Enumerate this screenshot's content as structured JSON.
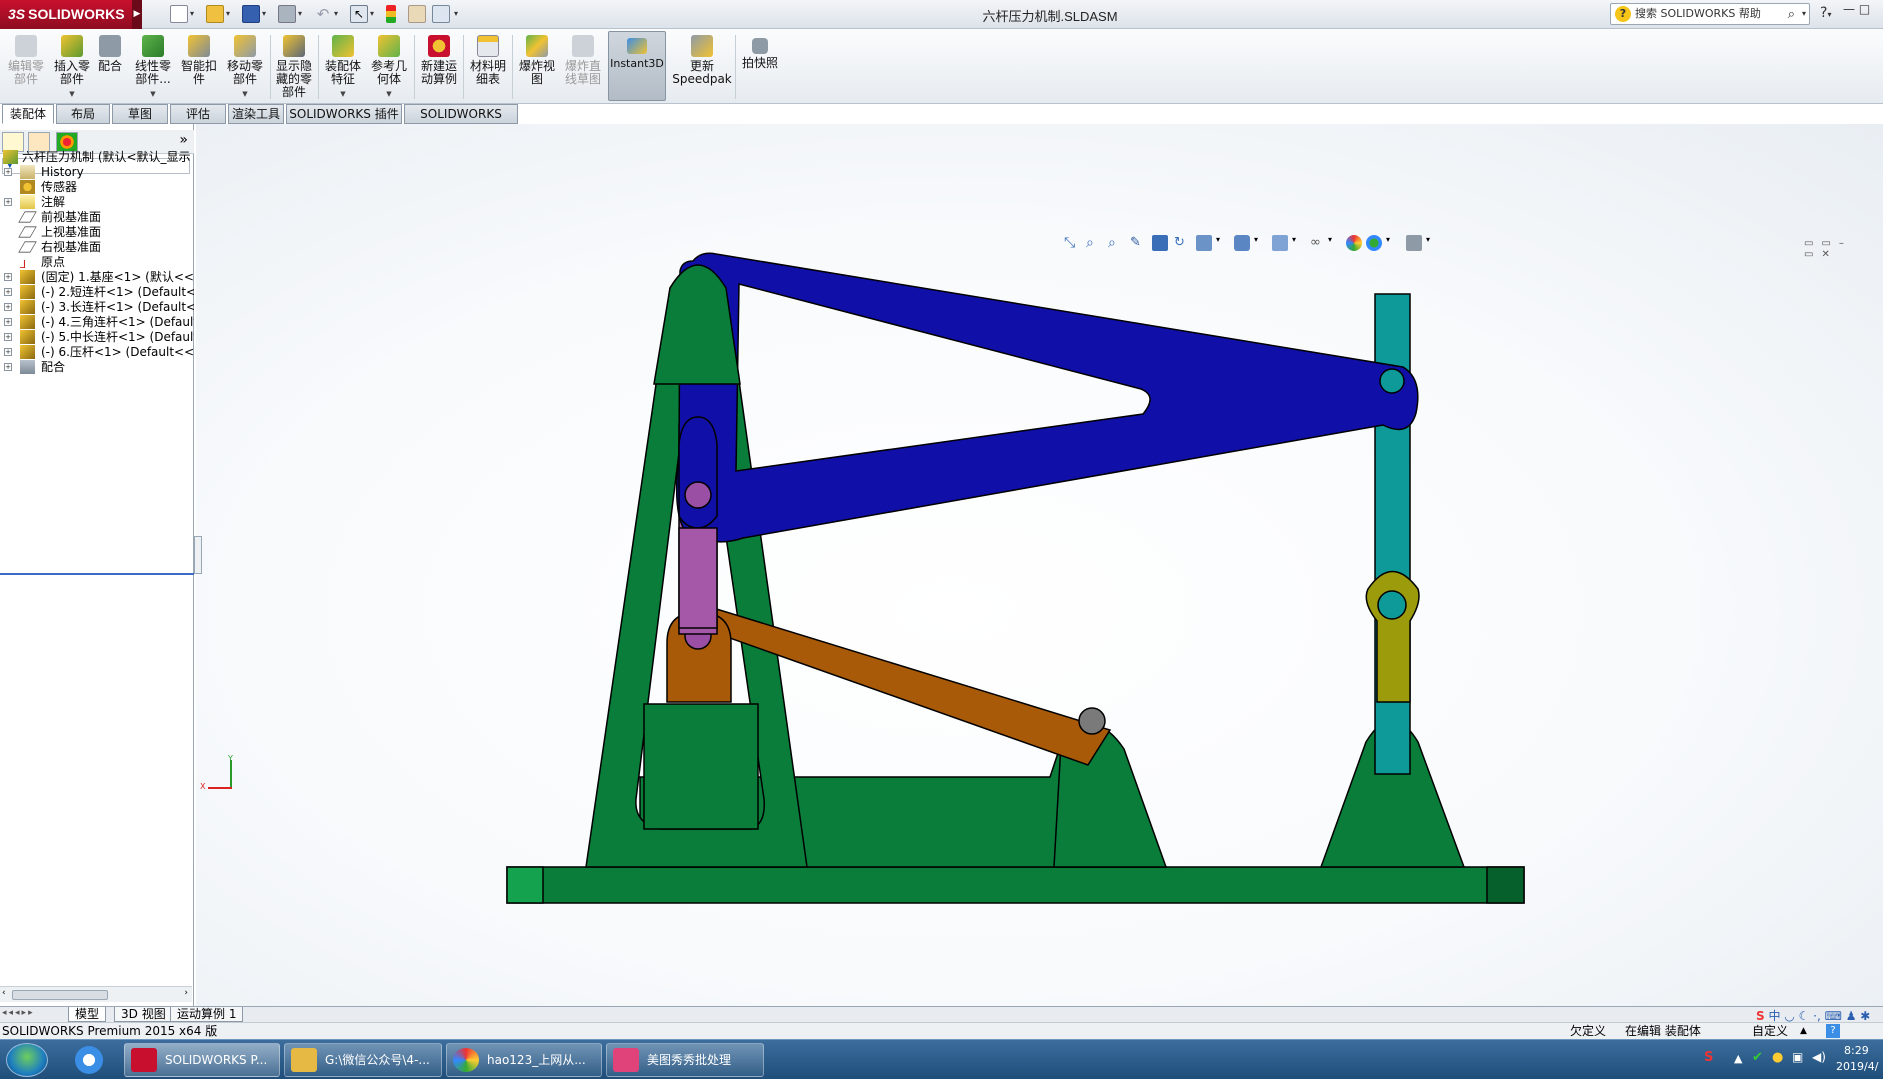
{
  "app": {
    "logo_text": "SOLIDWORKS",
    "window_title": "六杆压力机制.SLDASM",
    "search_placeholder": "搜索 SOLIDWORKS 帮助"
  },
  "toolbar": {
    "commands": [
      {
        "id": "edit-component",
        "label": "编辑零\n部件",
        "enabled": false,
        "icon": "edit-component-icon"
      },
      {
        "id": "insert-component",
        "label": "插入零\n部件",
        "enabled": true,
        "icon": "insert-component-icon"
      },
      {
        "id": "mate",
        "label": "配合",
        "enabled": true,
        "icon": "mate-icon"
      },
      {
        "id": "linear-pattern",
        "label": "线性零\n部件...",
        "enabled": true,
        "icon": "linear-pattern-icon"
      },
      {
        "id": "smart-fasteners",
        "label": "智能扣\n件",
        "enabled": true,
        "icon": "smart-fasteners-icon"
      },
      {
        "id": "move-component",
        "label": "移动零\n部件",
        "enabled": true,
        "icon": "move-component-icon"
      },
      {
        "id": "show-hidden",
        "label": "显示隐\n藏的零\n部件",
        "enabled": true,
        "icon": "show-hidden-icon"
      },
      {
        "id": "assembly-features",
        "label": "装配体\n特征",
        "enabled": true,
        "icon": "assembly-features-icon"
      },
      {
        "id": "reference-geometry",
        "label": "参考几\n何体",
        "enabled": true,
        "icon": "reference-geometry-icon"
      },
      {
        "id": "new-motion-study",
        "label": "新建运\n动算例",
        "enabled": true,
        "icon": "motion-study-icon"
      },
      {
        "id": "bom",
        "label": "材料明\n细表",
        "enabled": true,
        "icon": "bom-icon"
      },
      {
        "id": "exploded-view",
        "label": "爆炸视\n图",
        "enabled": true,
        "icon": "exploded-view-icon"
      },
      {
        "id": "explode-line",
        "label": "爆炸直\n线草图",
        "enabled": false,
        "icon": "explode-line-icon"
      },
      {
        "id": "instant3d",
        "label": "Instant3D",
        "enabled": true,
        "active": true,
        "icon": "instant3d-icon"
      },
      {
        "id": "update-speedpak",
        "label": "更新\nSpeedpak",
        "enabled": true,
        "icon": "speedpak-icon"
      },
      {
        "id": "snapshot",
        "label": "拍快照",
        "enabled": true,
        "icon": "snapshot-icon"
      }
    ]
  },
  "tabs": [
    "装配体",
    "布局",
    "草图",
    "评估",
    "渲染工具",
    "SOLIDWORKS 插件",
    "SOLIDWORKS MBD"
  ],
  "feature_tree": {
    "root": "六杆压力机制 (默认<默认_显示",
    "items": [
      {
        "label": "History",
        "icon": "history-icon",
        "expandable": true
      },
      {
        "label": "传感器",
        "icon": "sensor-icon",
        "expandable": false
      },
      {
        "label": "注解",
        "icon": "annotation-icon",
        "expandable": true
      },
      {
        "label": "前视基准面",
        "icon": "plane-icon",
        "expandable": false
      },
      {
        "label": "上视基准面",
        "icon": "plane-icon",
        "expandable": false
      },
      {
        "label": "右视基准面",
        "icon": "plane-icon",
        "expandable": false
      },
      {
        "label": "原点",
        "icon": "origin-icon",
        "expandable": false
      },
      {
        "label": "(固定) 1.基座<1> (默认<<默",
        "icon": "part-icon",
        "expandable": true
      },
      {
        "label": "(-) 2.短连杆<1> (Default<<",
        "icon": "part-icon",
        "expandable": true
      },
      {
        "label": "(-) 3.长连杆<1> (Default<<",
        "icon": "part-icon",
        "expandable": true
      },
      {
        "label": "(-) 4.三角连杆<1> (Default",
        "icon": "part-icon",
        "expandable": true
      },
      {
        "label": "(-) 5.中长连杆<1> (Default",
        "icon": "part-icon",
        "expandable": true
      },
      {
        "label": "(-) 6.压杆<1> (Default<<D",
        "icon": "part-icon",
        "expandable": true
      },
      {
        "label": "配合",
        "icon": "mates-icon",
        "expandable": true
      }
    ]
  },
  "triad": {
    "x_label": "X",
    "y_label": "Y"
  },
  "bottom_tabs": [
    "模型",
    "3D 视图",
    "运动算例 1"
  ],
  "status": {
    "product": "SOLIDWORKS Premium 2015 x64 版",
    "definition": "欠定义",
    "editing": "在编辑 装配体",
    "custom": "自定义"
  },
  "taskbar": {
    "items": [
      {
        "label": "SOLIDWORKS P...",
        "color": "#c8102e"
      },
      {
        "label": "G:\\微信公众号\\4-...",
        "color": "#e5b943"
      },
      {
        "label": "hao123_上网从...",
        "color": "#3a8ee6"
      },
      {
        "label": "美图秀秀批处理",
        "color": "#e0437a"
      }
    ],
    "clock_time": "8:29",
    "clock_date": "2019/4/"
  },
  "colors": {
    "base_green": "#0a7d3a",
    "link_blue": "#1010a8",
    "link_teal": "#0f9a9a",
    "link_olive": "#9b9b0c",
    "link_purple": "#a558a8",
    "link_brown": "#a95a08",
    "pin_gray": "#7a7a7a",
    "pin_purple": "#9a4fa5"
  }
}
